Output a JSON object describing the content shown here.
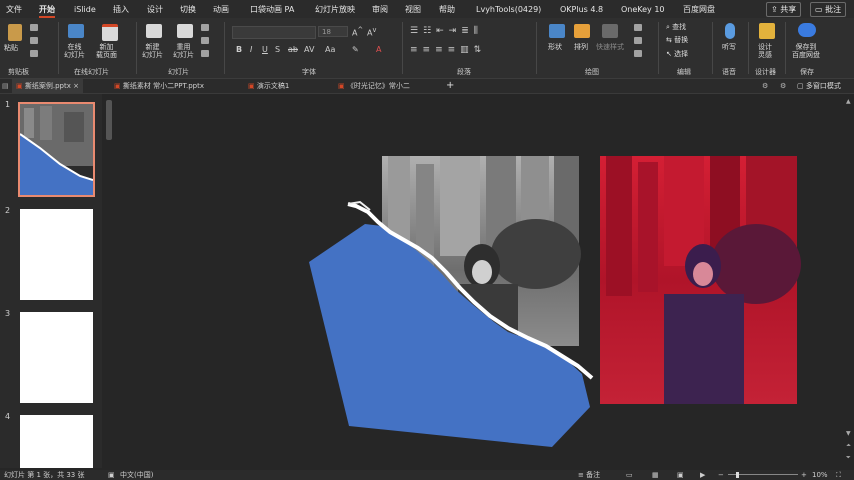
{
  "menu": {
    "tabs": [
      "文件",
      "开始",
      "iSlide",
      "插入",
      "设计",
      "切换",
      "动画",
      "口袋动画 PA",
      "幻灯片放映",
      "审阅",
      "视图",
      "帮助",
      "LvyhTools(0429)",
      "OKPlus 4.8",
      "OneKey 10",
      "百度网盘"
    ],
    "active_tab": "开始",
    "share_label": "共享",
    "comment_label": "批注"
  },
  "ribbon": {
    "groups": [
      "剪贴板",
      "在线幻灯片",
      "幻灯片",
      "字体",
      "段落",
      "绘图",
      "编辑",
      "语音",
      "设计器",
      "保存"
    ],
    "paste": "粘贴",
    "online_slides_1": "在线",
    "online_slides_2": "幻灯片",
    "new_slide_1": "新加",
    "new_slide_2": "载页面",
    "new_slide_b1": "新建",
    "new_slide_b2": "幻灯片",
    "reuse_1": "重用",
    "reuse_2": "幻灯片",
    "font_size": "18",
    "shape": "形状",
    "arrange": "排列",
    "quick_style": "快速样式",
    "find": "查找",
    "replace": "替换",
    "select": "选择",
    "dictate": "听写",
    "designer_1": "设计",
    "designer_2": "灵感",
    "save_baidu_1": "保存到",
    "save_baidu_2": "百度网盘"
  },
  "doc_tabs": [
    {
      "label": "撕纸案例.pptx",
      "active": true
    },
    {
      "label": "撕纸素材 常小二PPT.pptx",
      "active": false
    },
    {
      "label": "演示文稿1",
      "active": false
    },
    {
      "label": "《时光记忆》常小二",
      "active": false
    }
  ],
  "multi_window": "多窗口模式",
  "slides": [
    "1",
    "2",
    "3",
    "4"
  ],
  "status": {
    "slide_info": "幻灯片 第 1 张，共 33 张",
    "language": "中文(中国)",
    "notes": "备注",
    "zoom": "10%"
  },
  "colors": {
    "accent": "#d24726",
    "blue_shape": "#4472c4",
    "red_photo": "#c8182e"
  }
}
